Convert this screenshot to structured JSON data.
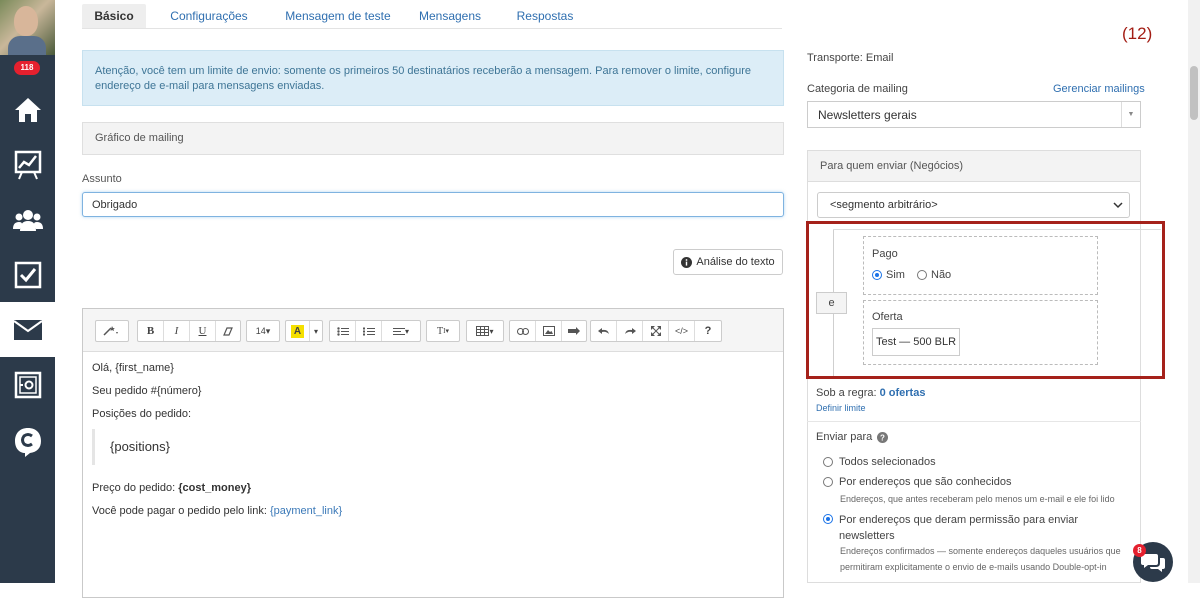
{
  "sidebar": {
    "notification_count": "118"
  },
  "tabs": [
    {
      "label": "Básico"
    },
    {
      "label": "Configurações"
    },
    {
      "label": "Mensagem de teste"
    },
    {
      "label": "Mensagens"
    },
    {
      "label": "Respostas"
    }
  ],
  "counter": "(12)",
  "alert": {
    "text": "Atenção, você tem um limite de envio: somente os primeiros 50 destinatários receberão a mensagem. Para remover o limite, configure endereço de e-mail para mensagens enviadas."
  },
  "mailing_chart": {
    "label": "Gráfico de mailing"
  },
  "subject": {
    "label": "Assunto",
    "value": "Obrigado"
  },
  "text_analysis_button": "Análise do texto",
  "editor": {
    "font_size": "14",
    "lines": {
      "greeting": "Olá, {first_name}",
      "order": "Seu pedido #{número}",
      "positions_label": "Posições do pedido:",
      "positions_var": "{positions}",
      "price_label": "Preço do pedido: ",
      "price_var": "{cost_money}",
      "pay_label": "Você pode pagar o pedido pelo link: ",
      "pay_var": "{payment_link}"
    }
  },
  "right": {
    "transport": "Transporte: Email",
    "category_label": "Categoria de mailing",
    "manage_link": "Gerenciar mailings",
    "category_value": "Newsletters gerais",
    "who_header": "Para quem enviar (Negócios)",
    "segment_value": "<segmento arbitrário>",
    "and_button": "e",
    "paid": {
      "label": "Pago",
      "yes": "Sim",
      "no": "Não",
      "selected": "Sim"
    },
    "offer": {
      "label": "Oferta",
      "value": "Test — 500 BLR"
    },
    "rule_prefix": "Sob a regra: ",
    "rule_value": "0 ofertas",
    "define_limit": "Definir limite",
    "send_to_label": "Enviar para",
    "options": [
      {
        "label": "Todos selecionados",
        "desc": ""
      },
      {
        "label": "Por endereços que são conhecidos",
        "desc": "Endereços, que antes receberam pelo menos um e-mail e ele foi lido"
      },
      {
        "label": "Por endereços que deram permissão para enviar newsletters",
        "desc": "Endereços confirmados — somente endereços daqueles usuários que permitiram explicitamente o envio de e-mails usando Double-opt-in"
      }
    ],
    "selected_option": 2
  },
  "chat_badge": "8",
  "colors": {
    "sidebar": "#2c3a4a",
    "link": "#2f6fb0",
    "highlight": "#a5211a",
    "alert_bg": "#dcedf7"
  }
}
